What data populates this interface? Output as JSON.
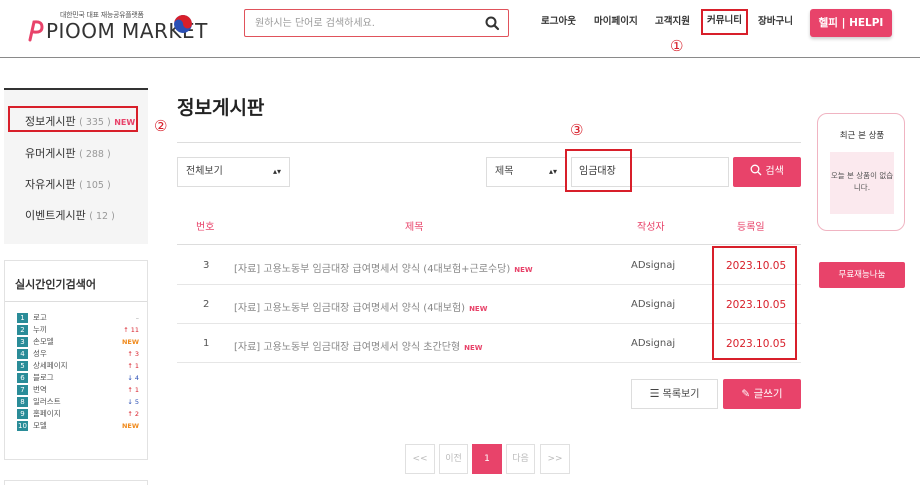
{
  "colors": {
    "accent": "#e8436a",
    "annotation_red": "#d81f2a",
    "teal_rank": "#2a8c98"
  },
  "header": {
    "tagline": "대한민국 대표 재능공유플랫폼",
    "logo_text": "PIOOM MARKET",
    "search_placeholder": "원하시는 단어로 검색하세요.",
    "nav": [
      "로그아웃",
      "마이페이지",
      "고객지원",
      "커뮤니티",
      "장바구니"
    ],
    "helpi_label": "헬피 | HELPI"
  },
  "annotations": {
    "one": "①",
    "two": "②",
    "three": "③"
  },
  "sidebar": {
    "boards": [
      {
        "label": "정보게시판",
        "count": "( 335 )",
        "badge": "NEW"
      },
      {
        "label": "유머게시판",
        "count": "( 288 )",
        "badge": ""
      },
      {
        "label": "자유게시판",
        "count": "( 105 )",
        "badge": ""
      },
      {
        "label": "이벤트게시판",
        "count": "( 12 )",
        "badge": ""
      }
    ],
    "popular_title": "실시간인기검색어",
    "keywords": [
      {
        "rank": "1",
        "word": "로고",
        "change": "–",
        "dir": "nochg"
      },
      {
        "rank": "2",
        "word": "누끼",
        "change": "↑ 11",
        "dir": "up"
      },
      {
        "rank": "3",
        "word": "손모델",
        "change": "NEW",
        "dir": "newb"
      },
      {
        "rank": "4",
        "word": "성우",
        "change": "↑ 3",
        "dir": "up"
      },
      {
        "rank": "5",
        "word": "상세페이지",
        "change": "↑ 1",
        "dir": "up"
      },
      {
        "rank": "6",
        "word": "블로그",
        "change": "↓ 4",
        "dir": "down"
      },
      {
        "rank": "7",
        "word": "번역",
        "change": "↑ 1",
        "dir": "up"
      },
      {
        "rank": "8",
        "word": "일러스트",
        "change": "↓ 5",
        "dir": "down"
      },
      {
        "rank": "9",
        "word": "홈페이지",
        "change": "↑ 2",
        "dir": "up"
      },
      {
        "rank": "10",
        "word": "모델",
        "change": "NEW",
        "dir": "newb"
      }
    ]
  },
  "main": {
    "title": "정보게시판",
    "filter_select": "전체보기",
    "field_select": "제목",
    "keyword_value": "임금대장",
    "search_button": "검색",
    "columns": [
      "번호",
      "제목",
      "작성자",
      "등록일"
    ],
    "rows": [
      {
        "no": "3",
        "subject": "[자료] 고용노동부 임금대장 급여명세서 양식 (4대보험+근로수당)",
        "badge": "NEW",
        "author": "ADsignaj",
        "date": "2023.10.05"
      },
      {
        "no": "2",
        "subject": "[자료] 고용노동부 임금대장 급여명세서 양식 (4대보험)",
        "badge": "NEW",
        "author": "ADsignaj",
        "date": "2023.10.05"
      },
      {
        "no": "1",
        "subject": "[자료] 고용노동부 임금대장 급여명세서 양식 초간단형",
        "badge": "NEW",
        "author": "ADsignaj",
        "date": "2023.10.05"
      }
    ],
    "list_button": "목록보기",
    "write_button": "글쓰기",
    "pagination": [
      "<<",
      "이전",
      "1",
      "다음",
      ">>"
    ]
  },
  "right": {
    "recent_title": "최근 본 상품",
    "recent_empty": "오늘 본 상품이 없습니다.",
    "free_button": "무료재능나눔"
  }
}
